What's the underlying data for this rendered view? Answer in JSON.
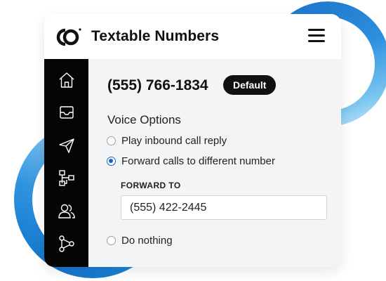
{
  "header": {
    "app_title": "Textable Numbers"
  },
  "sidebar": {
    "items": [
      {
        "icon": "home-icon"
      },
      {
        "icon": "inbox-icon"
      },
      {
        "icon": "send-icon"
      },
      {
        "icon": "workflow-icon"
      },
      {
        "icon": "contacts-icon"
      },
      {
        "icon": "integrations-icon"
      }
    ]
  },
  "number": {
    "phone": "(555) 766-1834",
    "badge": "Default"
  },
  "voice_options": {
    "title": "Voice Options",
    "options": [
      {
        "label": "Play inbound call reply",
        "selected": false
      },
      {
        "label": "Forward calls to different number",
        "selected": true
      },
      {
        "label": "Do nothing",
        "selected": false
      }
    ],
    "forward_to_label": "FORWARD TO",
    "forward_to_value": "(555) 422-2445"
  },
  "colors": {
    "accent": "#1565c0",
    "sidebar_bg": "#050505",
    "ring_blue": "#2c8fde"
  }
}
